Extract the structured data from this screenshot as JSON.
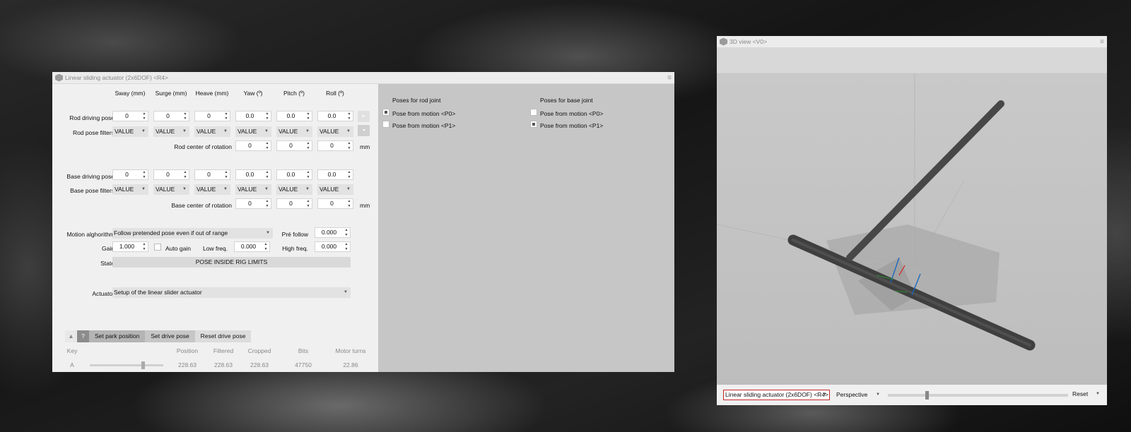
{
  "actuator_window": {
    "title": "Linear sliding actuator (2x6DOF) <R4>",
    "columns": [
      "Sway (mm)",
      "Surge (mm)",
      "Heave (mm)",
      "Yaw (º)",
      "Pitch (º)",
      "Roll (º)"
    ],
    "rod_driving_pose": {
      "label": "Rod driving pose",
      "values": [
        "0",
        "0",
        "0",
        "0.0",
        "0.0",
        "0.0"
      ]
    },
    "rod_pose_filters": {
      "label": "Rod pose filters",
      "values": [
        "VALUE",
        "VALUE",
        "VALUE",
        "VALUE",
        "VALUE",
        "VALUE"
      ]
    },
    "rod_center": {
      "label": "Rod center of rotation",
      "values": [
        "0",
        "0",
        "0"
      ],
      "unit": "mm"
    },
    "base_driving_pose": {
      "label": "Base driving pose",
      "values": [
        "0",
        "0",
        "0",
        "0.0",
        "0.0",
        "0.0"
      ]
    },
    "base_pose_filters": {
      "label": "Base pose filters",
      "values": [
        "VALUE",
        "VALUE",
        "VALUE",
        "VALUE",
        "VALUE",
        "VALUE"
      ]
    },
    "base_center": {
      "label": "Base center of rotation",
      "values": [
        "0",
        "0",
        "0"
      ],
      "unit": "mm"
    },
    "motion_algorithm": {
      "label": "Motion alghorithm",
      "value": "Follow pretended pose even if out of range"
    },
    "pre_follow": {
      "label": "Pré follow",
      "value": "0.000"
    },
    "gain": {
      "label": "Gain",
      "value": "1.000"
    },
    "auto_gain": {
      "label": "Auto gain",
      "checked": false
    },
    "low_freq": {
      "label": "Low freq.",
      "value": "0.000"
    },
    "high_freq": {
      "label": "High freq.",
      "value": "0.000"
    },
    "state": {
      "label": "State",
      "value": "POSE INSIDE RIG LIMITS"
    },
    "actuator": {
      "label": "Actuator",
      "value": "Setup of the linear slider actuator"
    },
    "side_buttons": {
      "next": "▸",
      "prev": "◂"
    },
    "bottom_tabs": {
      "collapse": "▲",
      "help": "?",
      "park": "Set park position",
      "drive": "Set drive pose",
      "reset": "Reset drive pose"
    },
    "table": {
      "headers": [
        "Key",
        "Position",
        "Filtered",
        "Cropped",
        "Bits",
        "Motor turns"
      ],
      "row": {
        "key": "A",
        "position": "228.63",
        "filtered": "228.63",
        "cropped": "228.63",
        "bits": "47750",
        "motor_turns": "22.86",
        "slider_fraction": 0.74
      }
    },
    "poses_rod": {
      "header": "Poses for rod joint",
      "items": [
        {
          "label": "Pose from motion <P0>",
          "checked": true
        },
        {
          "label": "Pose from motion <P1>",
          "checked": false
        }
      ]
    },
    "poses_base": {
      "header": "Poses for base joint",
      "items": [
        {
          "label": "Pose from motion <P0>",
          "checked": false
        },
        {
          "label": "Pose from motion <P1>",
          "checked": true
        }
      ]
    }
  },
  "view_window": {
    "title": "3D view <V0>",
    "object_select": "Linear sliding actuator (2x6DOF) <R4>",
    "projection": "Perspective",
    "zoom_fraction": 0.21,
    "reset": "Reset",
    "colors": {
      "highlight_border": "#c62828",
      "axis_x": "#d32f2f",
      "axis_y": "#2e7d32",
      "axis_z": "#1565c0"
    }
  },
  "icons": {
    "window": "app-icon",
    "menu": "hamburger-menu-icon",
    "dropdown": "chevron-down-icon",
    "spin": "spin-arrows-icon"
  }
}
